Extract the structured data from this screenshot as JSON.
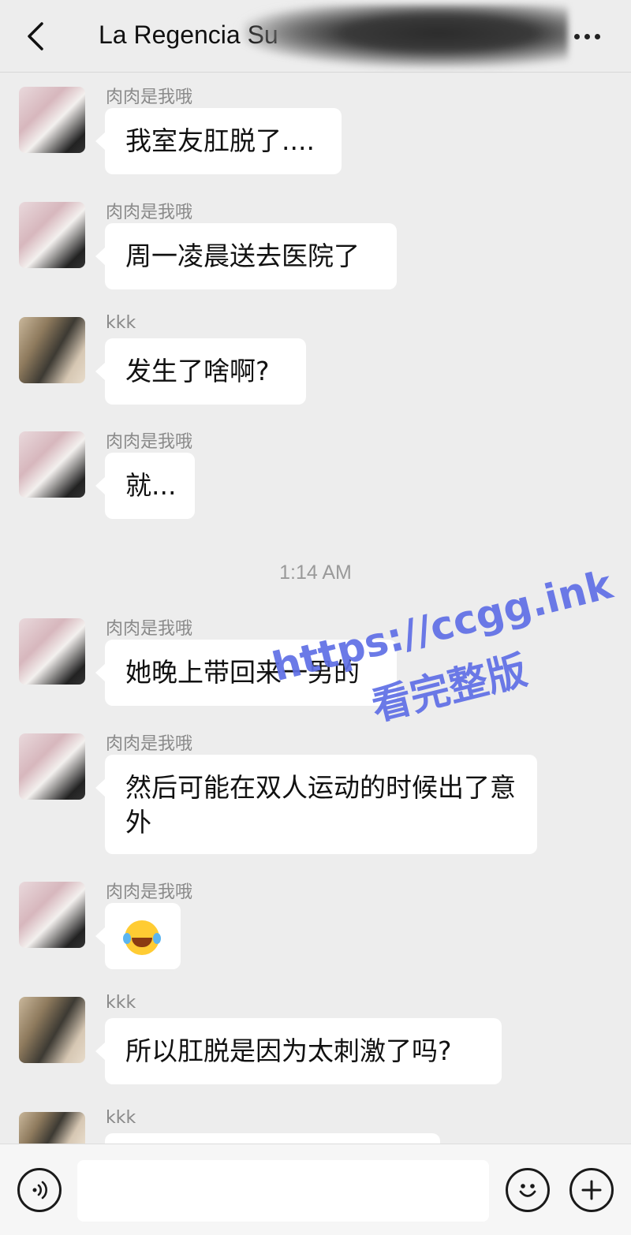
{
  "header": {
    "title": "La Regencia Su"
  },
  "messages": [
    {
      "sender": "肉肉是我哦",
      "text": "我室友肛脱了...."
    },
    {
      "sender": "肉肉是我哦",
      "text": "周一凌晨送去医院了"
    },
    {
      "sender": "kkk",
      "text": "发生了啥啊?"
    },
    {
      "sender": "肉肉是我哦",
      "text": "就..."
    },
    {
      "sender": "肉肉是我哦",
      "text": "她晚上带回来一男的"
    },
    {
      "sender": "肉肉是我哦",
      "text": "然后可能在双人运动的时候出了意外"
    },
    {
      "sender": "肉肉是我哦",
      "emoji": "tears-of-joy-emoji"
    },
    {
      "sender": "kkk",
      "text": "所以肛脱是因为太刺激了吗?"
    },
    {
      "sender": "kkk",
      "text": ""
    }
  ],
  "timestamp": "1:14 AM",
  "watermark": {
    "line1": "https://ccgg.ink",
    "line2": "看完整版"
  },
  "input": {
    "value": ""
  },
  "icons": {
    "back": "chevron-left-icon",
    "more": "more-dots-icon",
    "voice": "voice-icon",
    "emoji": "smiley-icon",
    "plus": "plus-icon"
  }
}
